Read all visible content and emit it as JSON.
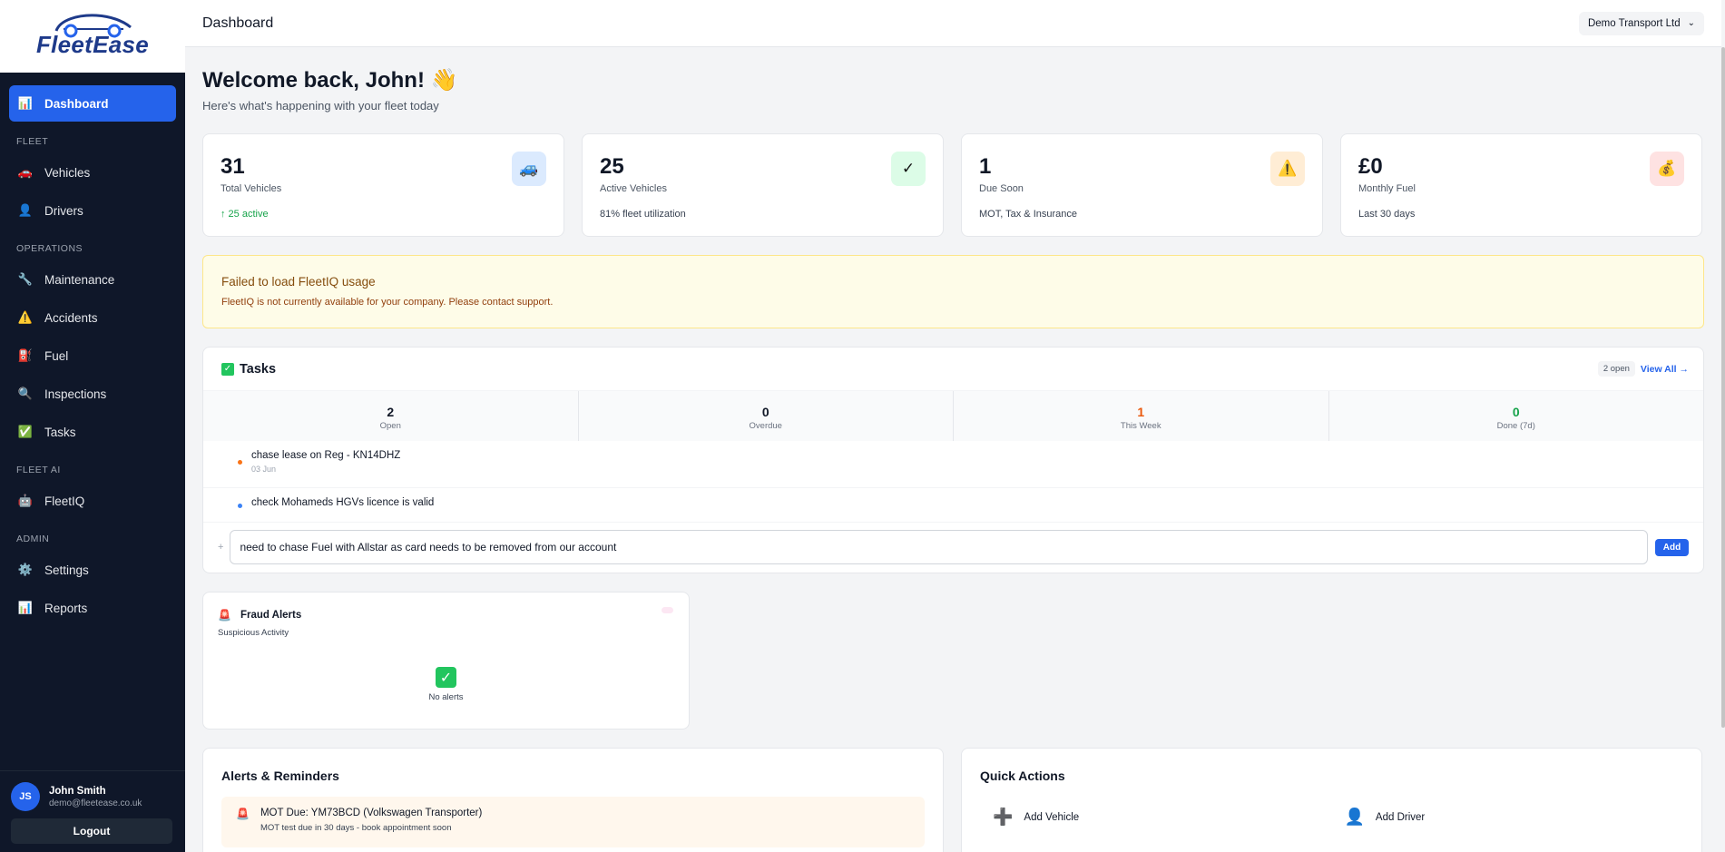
{
  "brand": {
    "name": "FleetEase"
  },
  "header": {
    "title": "Dashboard",
    "company": "Demo Transport Ltd"
  },
  "sidebar": {
    "dashboard": "Dashboard",
    "section_fleet": "FLEET",
    "vehicles": "Vehicles",
    "drivers": "Drivers",
    "section_operations": "OPERATIONS",
    "maintenance": "Maintenance",
    "accidents": "Accidents",
    "fuel": "Fuel",
    "inspections": "Inspections",
    "tasks": "Tasks",
    "section_fleet_ai": "FLEET AI",
    "fleetiq": "FleetIQ",
    "section_admin": "ADMIN",
    "settings": "Settings",
    "reports": "Reports"
  },
  "user": {
    "initials": "JS",
    "name": "John Smith",
    "email": "demo@fleetease.co.uk",
    "logout": "Logout"
  },
  "welcome": {
    "title": "Welcome back, John! 👋",
    "subtitle": "Here's what's happening with your fleet today"
  },
  "stats": [
    {
      "value": "31",
      "label": "Total Vehicles",
      "note": "↑ 25 active",
      "icon": "truck-icon",
      "icon_bg": "#dbeafe"
    },
    {
      "value": "25",
      "label": "Active Vehicles",
      "note": "81% fleet utilization",
      "icon": "check-icon",
      "icon_bg": "#dcfce7"
    },
    {
      "value": "1",
      "label": "Due Soon",
      "note": "MOT, Tax & Insurance",
      "icon": "warning-icon",
      "icon_bg": "#ffedd5"
    },
    {
      "value": "£0",
      "label": "Monthly Fuel",
      "note": "Last 30 days",
      "icon": "money-bag-icon",
      "icon_bg": "#fee2e2"
    }
  ],
  "fleetiq_error": {
    "title": "Failed to load FleetIQ usage",
    "message": "FleetIQ is not currently available for your company. Please contact support."
  },
  "tasks": {
    "title": "Tasks",
    "open_badge": "2 open",
    "view_all": "View All →",
    "summary": [
      {
        "value": "2",
        "label": "Open",
        "color": "#111827"
      },
      {
        "value": "0",
        "label": "Overdue",
        "color": "#111827"
      },
      {
        "value": "1",
        "label": "This Week",
        "color": "#ea580c"
      },
      {
        "value": "0",
        "label": "Done (7d)",
        "color": "#16a34a"
      }
    ],
    "items": [
      {
        "text": "chase lease on Reg - KN14DHZ",
        "date": "03 Jun",
        "dot": "#f97316"
      },
      {
        "text": "check Mohameds HGVs licence is valid",
        "date": "",
        "dot": "#3b82f6"
      }
    ],
    "new_task_value": "need to chase Fuel with Allstar as card needs to be removed from our account",
    "add_label": "Add"
  },
  "fraud": {
    "title": "Fraud Alerts",
    "subtitle": "Suspicious Activity",
    "empty": "No alerts"
  },
  "alerts": {
    "title": "Alerts & Reminders",
    "items": [
      {
        "title": "MOT Due: YM73BCD (Volkswagen Transporter)",
        "desc": "MOT test due in 30 days - book appointment soon"
      }
    ]
  },
  "quick_actions": {
    "title": "Quick Actions",
    "add_vehicle": "Add Vehicle",
    "add_driver": "Add Driver"
  }
}
